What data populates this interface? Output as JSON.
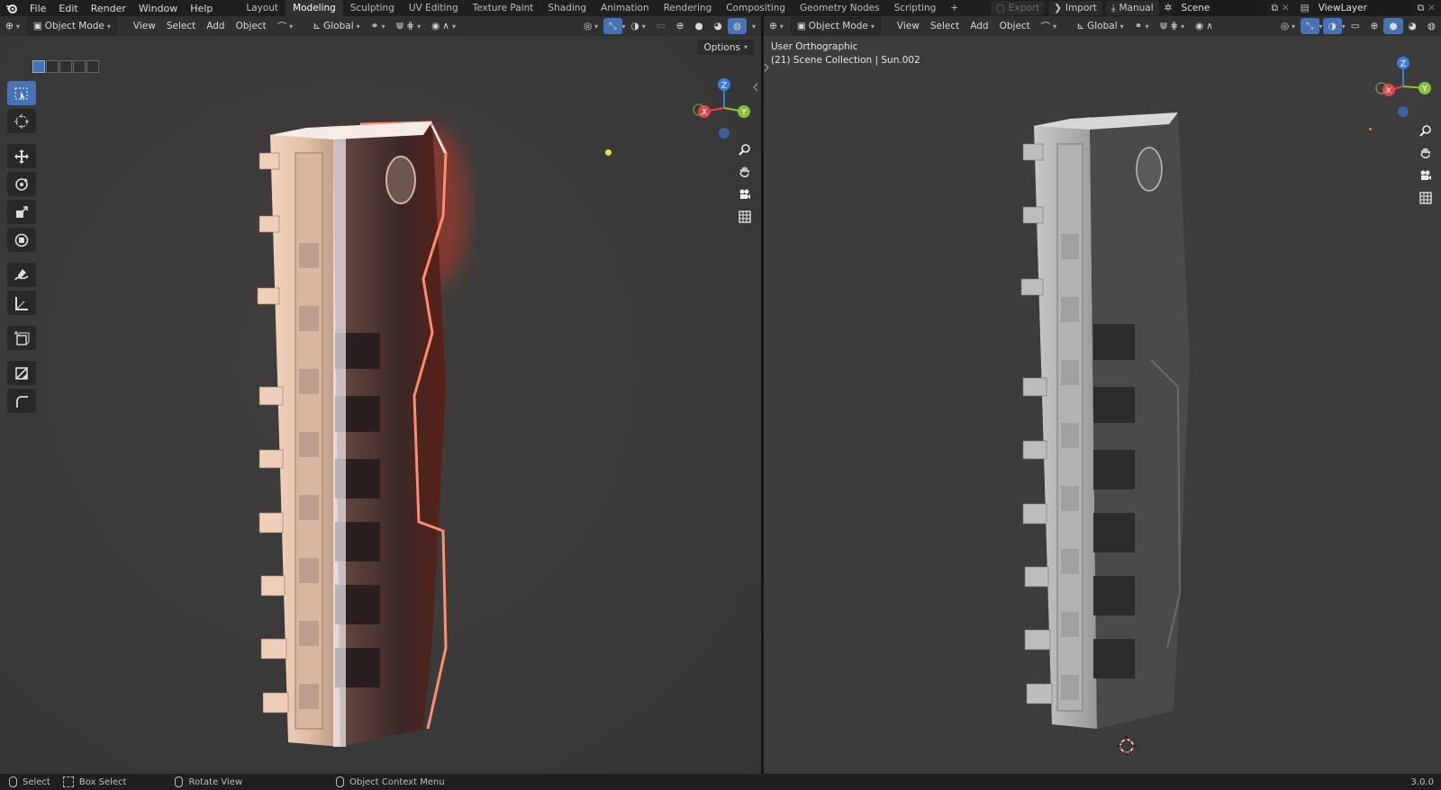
{
  "topbar": {
    "menus": [
      "File",
      "Edit",
      "Render",
      "Window",
      "Help"
    ],
    "workspaces": [
      "Layout",
      "Modeling",
      "Sculpting",
      "UV Editing",
      "Texture Paint",
      "Shading",
      "Animation",
      "Rendering",
      "Compositing",
      "Geometry Nodes",
      "Scripting"
    ],
    "active_workspace": "Modeling",
    "add_workspace": "+",
    "export_label": "Export",
    "import_label": "Import",
    "manual_label": "Manual",
    "scene_name": "Scene",
    "viewlayer_name": "ViewLayer"
  },
  "left_editor": {
    "mode": "Object Mode",
    "menus": [
      "View",
      "Select",
      "Add",
      "Object"
    ],
    "orientation": "Global",
    "options_label": "Options"
  },
  "right_editor": {
    "mode": "Object Mode",
    "menus": [
      "View",
      "Select",
      "Add",
      "Object"
    ],
    "orientation": "Global",
    "view_name": "User Orthographic",
    "collection_info": "(21) Scene Collection | Sun.002"
  },
  "gizmo": {
    "x": "X",
    "y": "Y",
    "z": "Z"
  },
  "status": {
    "select": "Select",
    "box_select": "Box Select",
    "rotate_view": "Rotate View",
    "context_menu": "Object Context Menu",
    "version": "3.0.0"
  },
  "colors": {
    "accent": "#4772b3",
    "axis_x": "#e04050",
    "axis_y": "#8cc03a",
    "axis_z": "#3b7fd8",
    "glow": "#ff4020"
  }
}
